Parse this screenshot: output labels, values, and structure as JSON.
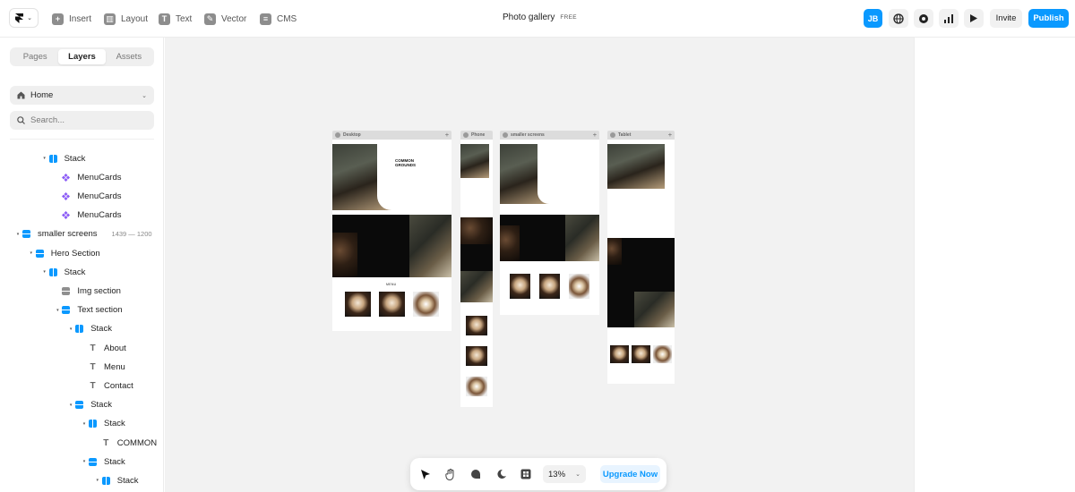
{
  "topbar": {
    "tools": [
      {
        "label": "Insert",
        "icon": "plus-square-icon"
      },
      {
        "label": "Layout",
        "icon": "layout-icon"
      },
      {
        "label": "Text",
        "icon": "text-icon"
      },
      {
        "label": "Vector",
        "icon": "pen-icon"
      },
      {
        "label": "CMS",
        "icon": "database-icon"
      }
    ],
    "project_title": "Photo gallery",
    "plan_badge": "FREE",
    "avatar_initials": "JB",
    "invite_label": "Invite",
    "publish_label": "Publish"
  },
  "sidebar": {
    "tabs": [
      "Pages",
      "Layers",
      "Assets"
    ],
    "active_tab": "Layers",
    "page_selector": "Home",
    "search_placeholder": "Search...",
    "layers": [
      {
        "label": "Stack",
        "type": "stack",
        "depth": 2
      },
      {
        "label": "MenuCards",
        "type": "component",
        "depth": 3
      },
      {
        "label": "MenuCards",
        "type": "component",
        "depth": 3
      },
      {
        "label": "MenuCards",
        "type": "component",
        "depth": 3
      },
      {
        "label": "smaller screens",
        "type": "frame",
        "depth": 0,
        "meta": "1439 — 1200"
      },
      {
        "label": "Hero Section",
        "type": "frame",
        "depth": 1
      },
      {
        "label": "Stack",
        "type": "stack",
        "depth": 2
      },
      {
        "label": "Img section",
        "type": "grey",
        "depth": 3
      },
      {
        "label": "Text section",
        "type": "frame",
        "depth": 3
      },
      {
        "label": "Stack",
        "type": "stack",
        "depth": 4
      },
      {
        "label": "About",
        "type": "text",
        "depth": 5
      },
      {
        "label": "Menu",
        "type": "text",
        "depth": 5
      },
      {
        "label": "Contact",
        "type": "text",
        "depth": 5
      },
      {
        "label": "Stack",
        "type": "frame",
        "depth": 4
      },
      {
        "label": "Stack",
        "type": "stack",
        "depth": 5
      },
      {
        "label": "COMMON",
        "type": "text",
        "depth": 6
      },
      {
        "label": "Stack",
        "type": "frame",
        "depth": 5
      },
      {
        "label": "Stack",
        "type": "stack",
        "depth": 6
      }
    ]
  },
  "canvas": {
    "breakpoints": [
      "Desktop",
      "Phone",
      "smaller screens",
      "Tablet"
    ],
    "site_heading_line1": "COMMON",
    "site_heading_line2": "GROUNDS",
    "menu_heading": "MENU"
  },
  "bottombar": {
    "zoom": "13%",
    "upgrade_label": "Upgrade Now"
  },
  "colors": {
    "accent": "#0a99ff",
    "canvas_bg": "#f2f2f2"
  }
}
